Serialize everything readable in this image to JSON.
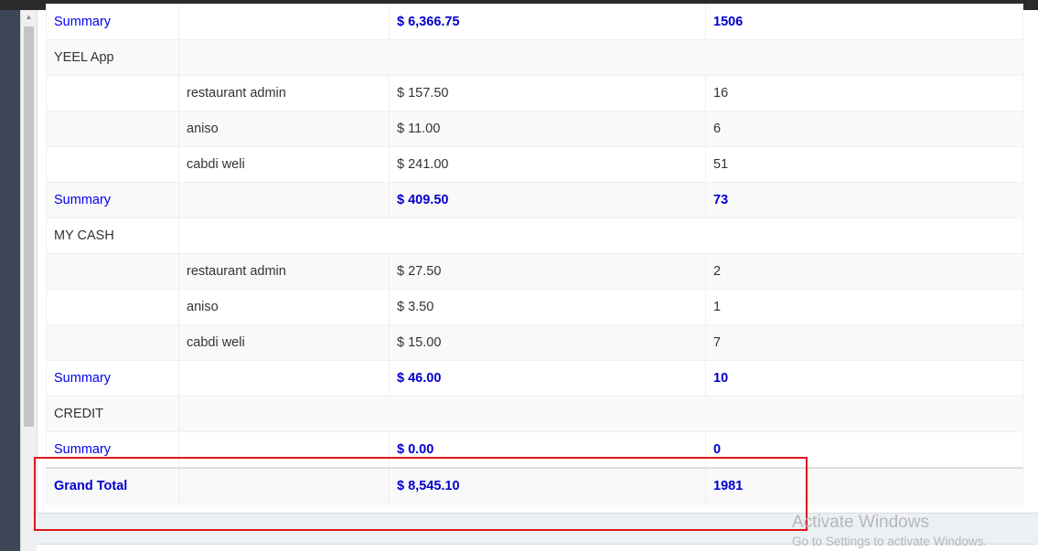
{
  "rows": [
    {
      "type": "summary",
      "label": "Summary",
      "amount": "$ 6,366.75",
      "count": "1506"
    },
    {
      "type": "group",
      "label": "YEEL App"
    },
    {
      "type": "item",
      "user": "restaurant admin",
      "amount": "$ 157.50",
      "count": "16"
    },
    {
      "type": "item",
      "user": "aniso",
      "amount": "$ 11.00",
      "count": "6"
    },
    {
      "type": "item",
      "user": "cabdi weli",
      "amount": "$ 241.00",
      "count": "51"
    },
    {
      "type": "summary",
      "label": "Summary",
      "amount": "$ 409.50",
      "count": "73"
    },
    {
      "type": "group",
      "label": "MY CASH"
    },
    {
      "type": "item",
      "user": "restaurant admin",
      "amount": "$ 27.50",
      "count": "2"
    },
    {
      "type": "item",
      "user": "aniso",
      "amount": "$ 3.50",
      "count": "1"
    },
    {
      "type": "item",
      "user": "cabdi weli",
      "amount": "$ 15.00",
      "count": "7"
    },
    {
      "type": "summary",
      "label": "Summary",
      "amount": "$ 46.00",
      "count": "10"
    },
    {
      "type": "group",
      "label": "CREDIT"
    },
    {
      "type": "summary",
      "label": "Summary",
      "amount": "$ 0.00",
      "count": "0"
    }
  ],
  "grand_total": {
    "label": "Grand Total",
    "amount": "$ 8,545.10",
    "count": "1981"
  },
  "watermark": {
    "title": "Activate Windows",
    "subtitle": "Go to Settings to activate Windows."
  },
  "colors": {
    "highlight_border": "#e0141e",
    "summary_text": "#0000ee",
    "bold_text": "#0000cc"
  },
  "icons": {
    "scroll_up": "▲"
  }
}
